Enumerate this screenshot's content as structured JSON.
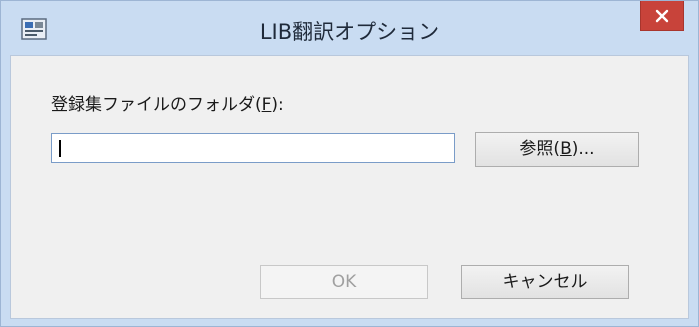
{
  "window": {
    "title": "LIB翻訳オプション",
    "app_icon": "app-icon",
    "close_icon": "close-icon",
    "close_color": "#c8433a"
  },
  "form": {
    "folder_label_prefix": "登録集ファイルのフォルダ(",
    "folder_label_mnemonic": "F",
    "folder_label_suffix": "):",
    "folder_value": ""
  },
  "buttons": {
    "browse_prefix": "参照(",
    "browse_mnemonic": "B",
    "browse_suffix": ")...",
    "ok_label": "OK",
    "ok_enabled": false,
    "cancel_label": "キャンセル"
  }
}
